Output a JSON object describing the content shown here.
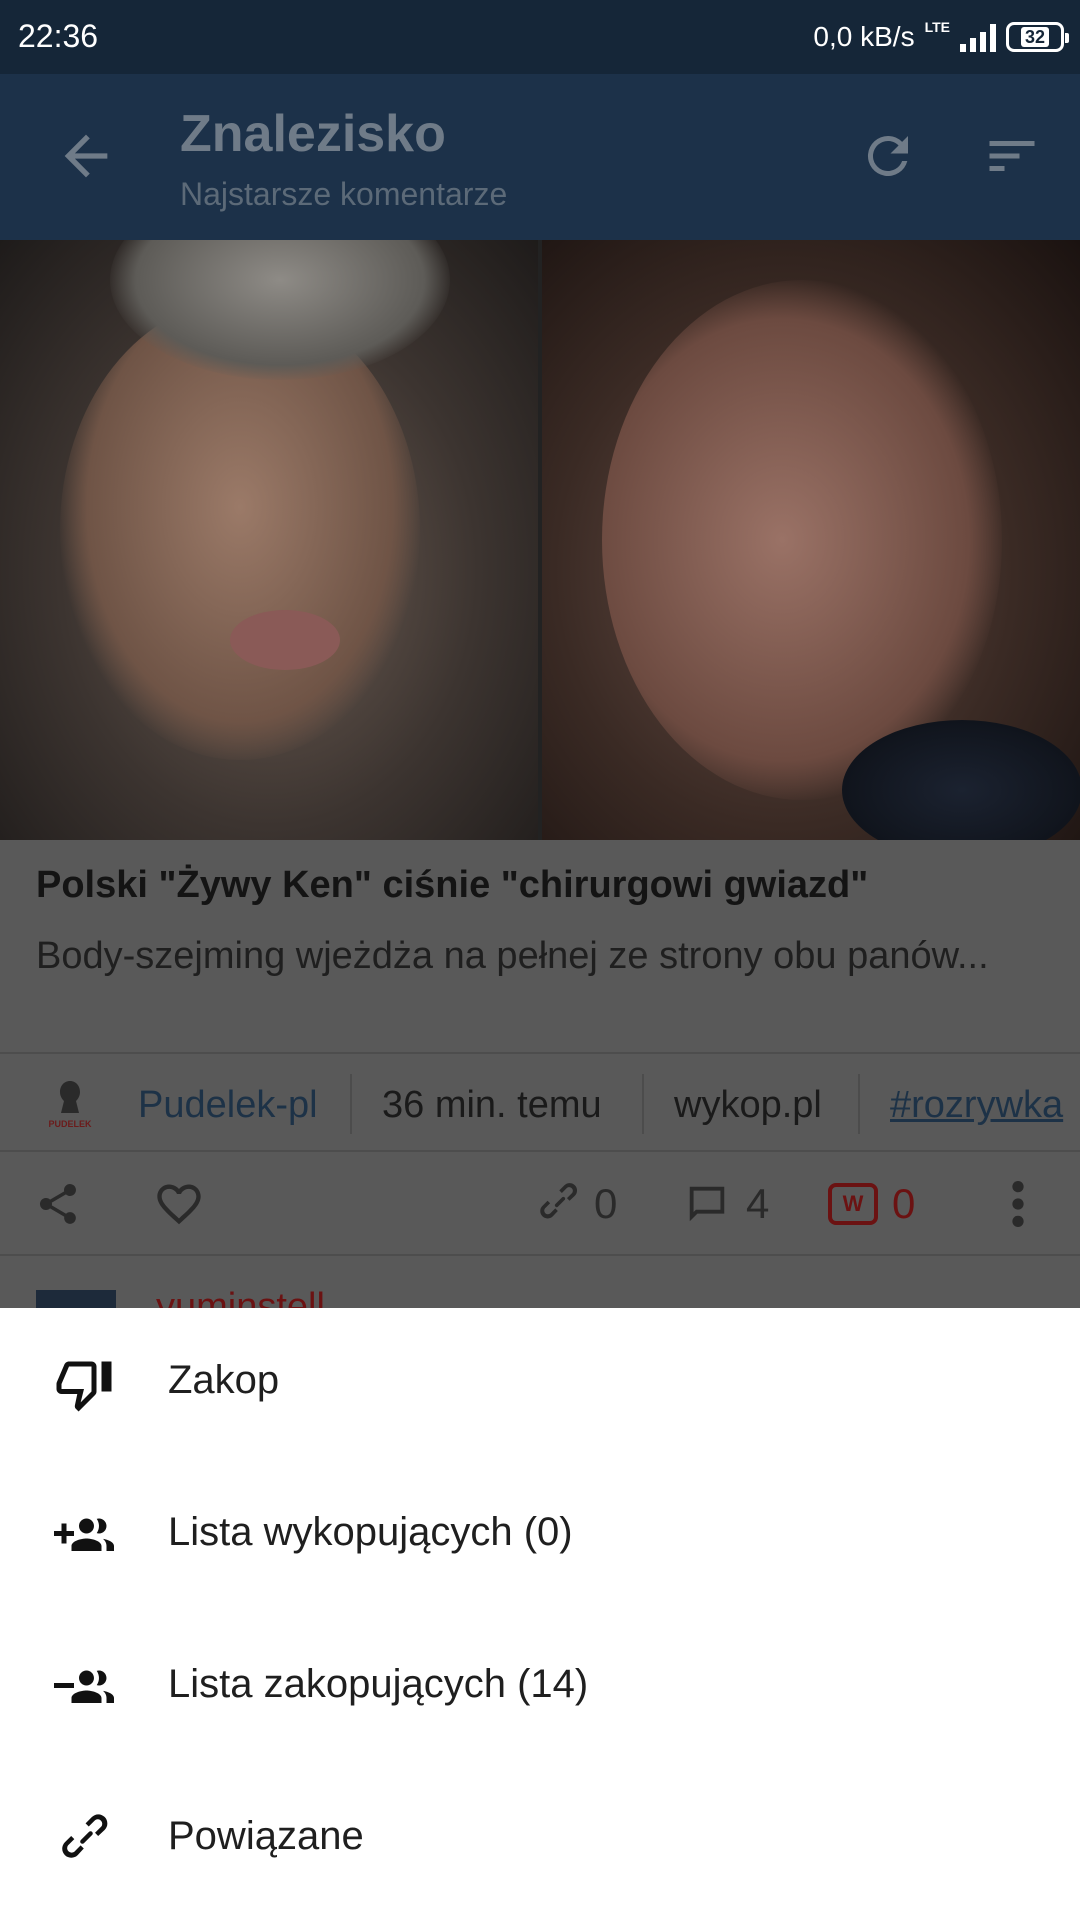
{
  "status_bar": {
    "time": "22:36",
    "network_speed": "0,0 kB/s",
    "network_type": "LTE",
    "battery": "32"
  },
  "app_bar": {
    "title": "Znalezisko",
    "subtitle": "Najstarsze komentarze",
    "icons": [
      "back-arrow-icon",
      "refresh-icon",
      "sort-icon"
    ]
  },
  "article": {
    "title": "Polski \"Żywy Ken\" ciśnie \"chirurgowi gwiazd\"",
    "description": "Body-szejming wjeżdża na pełnej ze strony obu panów...",
    "source_logo_text": "PUDELEK",
    "author": "Pudelek-pl",
    "time": "36 min. temu",
    "domain": "wykop.pl",
    "tag": "#rozrywka"
  },
  "actions": {
    "related_count": "0",
    "comments_count": "4",
    "votes_count": "0"
  },
  "comment_peek": {
    "author": "yuminstell"
  },
  "bottom_sheet": {
    "items": [
      {
        "label": "Zakop",
        "icon": "thumb-down-icon"
      },
      {
        "label": "Lista wykopujących (0)",
        "icon": "group-add-icon"
      },
      {
        "label": "Lista zakopujących (14)",
        "icon": "group-remove-icon"
      },
      {
        "label": "Powiązane",
        "icon": "link-icon"
      }
    ]
  },
  "colors": {
    "status_bar": "#152638",
    "app_bar": "#1c3149",
    "scrim_content": "#595959",
    "sheet": "#ffffff",
    "wykop_red": "#6b1212"
  }
}
